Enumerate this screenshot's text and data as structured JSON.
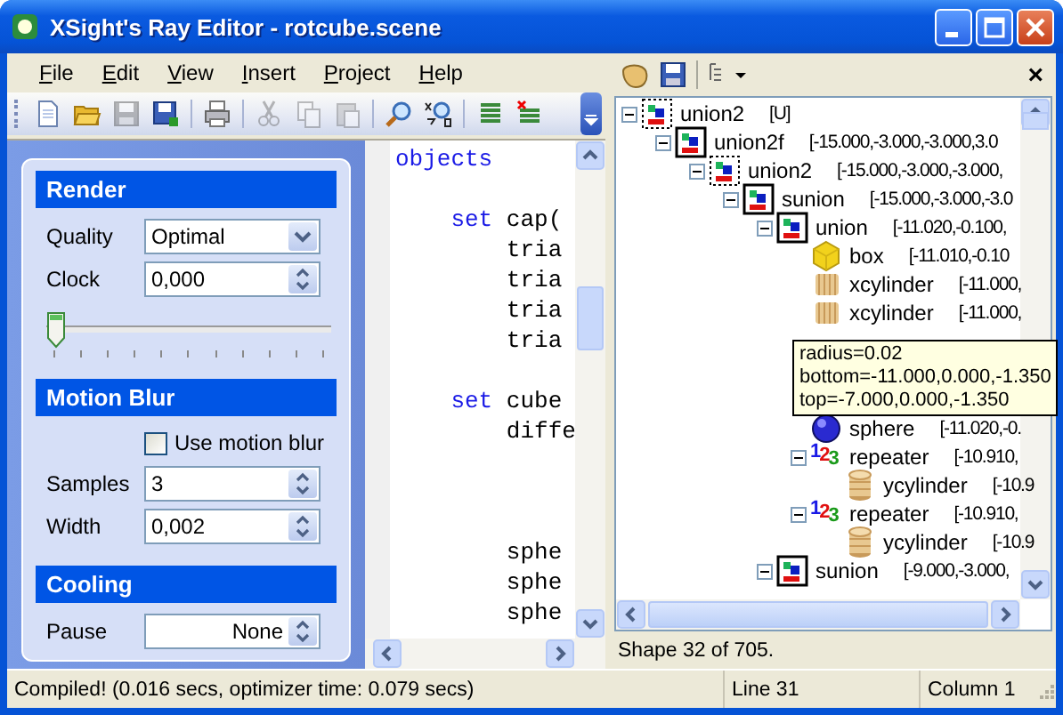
{
  "window": {
    "title": "XSight's Ray Editor - rotcube.scene"
  },
  "menu": [
    "File",
    "Edit",
    "View",
    "Insert",
    "Project",
    "Help"
  ],
  "toolbar": [
    {
      "kind": "new",
      "disabled": false
    },
    {
      "kind": "open",
      "disabled": false
    },
    {
      "kind": "save",
      "disabled": true
    },
    {
      "kind": "save-all",
      "disabled": false
    },
    {
      "kind": "separator"
    },
    {
      "kind": "print",
      "disabled": false
    },
    {
      "kind": "separator"
    },
    {
      "kind": "cut",
      "disabled": true
    },
    {
      "kind": "copy",
      "disabled": true
    },
    {
      "kind": "paste",
      "disabled": true
    },
    {
      "kind": "separator"
    },
    {
      "kind": "find",
      "disabled": false
    },
    {
      "kind": "replace",
      "disabled": false
    },
    {
      "kind": "separator"
    },
    {
      "kind": "list",
      "disabled": false
    },
    {
      "kind": "list-delete",
      "disabled": false
    }
  ],
  "task_pane": {
    "sections": [
      {
        "title": "Render",
        "rows": [
          {
            "kind": "combo",
            "label": "Quality",
            "value": "Optimal"
          },
          {
            "kind": "spin",
            "label": "Clock",
            "value": "0,000"
          },
          {
            "kind": "slider",
            "level": 0
          }
        ]
      },
      {
        "title": "Motion Blur",
        "rows": [
          {
            "kind": "checkbox",
            "label": "Use motion blur",
            "checked": false
          },
          {
            "kind": "spin",
            "label": "Samples",
            "value": "3"
          },
          {
            "kind": "spin",
            "label": "Width",
            "value": "0,002"
          }
        ]
      },
      {
        "title": "Cooling",
        "rows": [
          {
            "kind": "spin-right",
            "label": "Pause",
            "value": "None"
          }
        ]
      }
    ]
  },
  "editor": {
    "lines": [
      {
        "kind": "code",
        "tokens": [
          {
            "kind": "keyword",
            "text": "objects"
          }
        ]
      },
      {
        "kind": "blank"
      },
      {
        "kind": "code",
        "tokens": [
          {
            "kind": "keyword",
            "text": "    set"
          },
          {
            "kind": "plain",
            "text": " cap("
          }
        ]
      },
      {
        "kind": "code",
        "tokens": [
          {
            "kind": "plain",
            "text": "        tria"
          }
        ]
      },
      {
        "kind": "code",
        "tokens": [
          {
            "kind": "plain",
            "text": "        tria"
          }
        ]
      },
      {
        "kind": "code",
        "tokens": [
          {
            "kind": "plain",
            "text": "        tria"
          }
        ]
      },
      {
        "kind": "code",
        "tokens": [
          {
            "kind": "plain",
            "text": "        tria"
          }
        ]
      },
      {
        "kind": "blank"
      },
      {
        "kind": "code",
        "tokens": [
          {
            "kind": "keyword",
            "text": "    set"
          },
          {
            "kind": "plain",
            "text": " cube"
          }
        ]
      },
      {
        "kind": "code",
        "tokens": [
          {
            "kind": "plain",
            "text": "        diffe"
          }
        ]
      },
      {
        "kind": "blank"
      },
      {
        "kind": "blank"
      },
      {
        "kind": "blank"
      },
      {
        "kind": "code",
        "tokens": [
          {
            "kind": "plain",
            "text": "        sphe"
          }
        ]
      },
      {
        "kind": "code",
        "tokens": [
          {
            "kind": "plain",
            "text": "        sphe"
          }
        ]
      },
      {
        "kind": "code",
        "tokens": [
          {
            "kind": "plain",
            "text": "        sphe"
          }
        ]
      }
    ]
  },
  "tree_toolbar": {
    "close": "×"
  },
  "tree": {
    "items": [
      {
        "label": "union2",
        "bounds": "[U]",
        "kind": "csg-dotted",
        "expanded": true,
        "children": [
          {
            "label": "union2f",
            "bounds": "[-15.000,-3.000,-3.000,3.0",
            "kind": "csg",
            "expanded": true,
            "children": [
              {
                "label": "union2",
                "bounds": "[-15.000,-3.000,-3.000,",
                "kind": "csg-dotted",
                "expanded": true,
                "children": [
                  {
                    "label": "sunion",
                    "bounds": "[-15.000,-3.000,-3.0",
                    "kind": "csg",
                    "expanded": true,
                    "children": [
                      {
                        "label": "union",
                        "bounds": "[-11.020,-0.100,",
                        "kind": "csg",
                        "expanded": true,
                        "children": [
                          {
                            "label": "box",
                            "bounds": "[-11.010,-0.10",
                            "kind": "box"
                          },
                          {
                            "label": "xcylinder",
                            "bounds": "[-11.000,",
                            "kind": "xcylinder"
                          },
                          {
                            "label": "xcylinder",
                            "bounds": "[-11.000,",
                            "kind": "xcylinder",
                            "tooltip": [
                              "radius=0.02",
                              "bottom=-11.000,0.000,-1.350",
                              "top=-7.000,0.000,-1.350"
                            ]
                          },
                          {
                            "label": "sphere",
                            "bounds": "[-11.020,-0.",
                            "kind": "sphere"
                          },
                          {
                            "label": "repeater",
                            "bounds": "[-10.910,",
                            "kind": "repeater",
                            "glyph": "123",
                            "expanded": true,
                            "children": [
                              {
                                "label": "ycylinder",
                                "bounds": "[-10.9",
                                "kind": "ycylinder"
                              }
                            ]
                          },
                          {
                            "label": "repeater",
                            "bounds": "[-10.910,",
                            "kind": "repeater",
                            "glyph": "123",
                            "expanded": true,
                            "children": [
                              {
                                "label": "ycylinder",
                                "bounds": "[-10.9",
                                "kind": "ycylinder"
                              }
                            ]
                          }
                        ]
                      },
                      {
                        "label": "sunion",
                        "bounds": "[-9.000,-3.000,",
                        "kind": "csg",
                        "expanded": true
                      }
                    ]
                  }
                ]
              }
            ]
          }
        ]
      }
    ]
  },
  "tree_status": "Shape 32 of 705.",
  "status_bar": [
    "Compiled! (0.016 secs, optimizer time: 0.079 secs)",
    "Line 31",
    "Column 1"
  ]
}
